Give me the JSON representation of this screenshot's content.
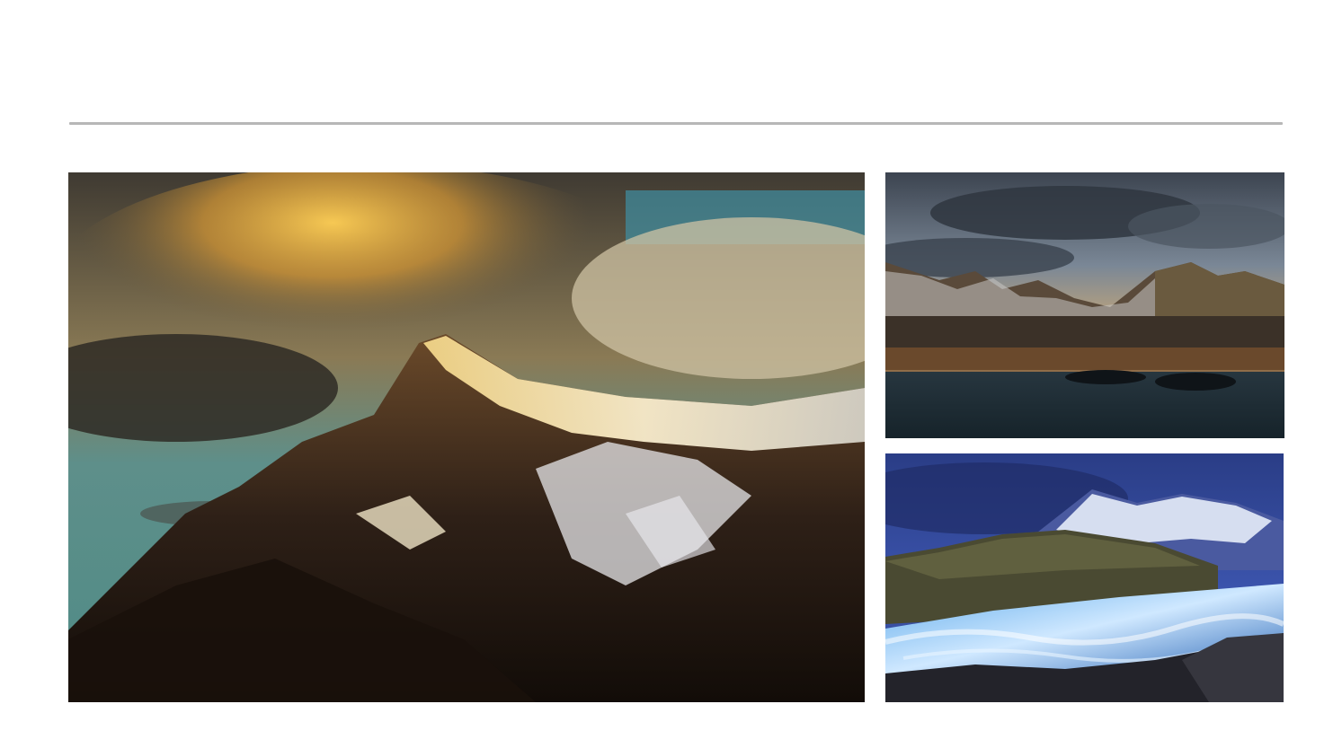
{
  "gallery": {
    "images": [
      {
        "name": "mountain-peak-golden-clouds-photo"
      },
      {
        "name": "lake-mountain-sunset-photo"
      },
      {
        "name": "river-rapids-blue-mountains-photo"
      }
    ]
  }
}
